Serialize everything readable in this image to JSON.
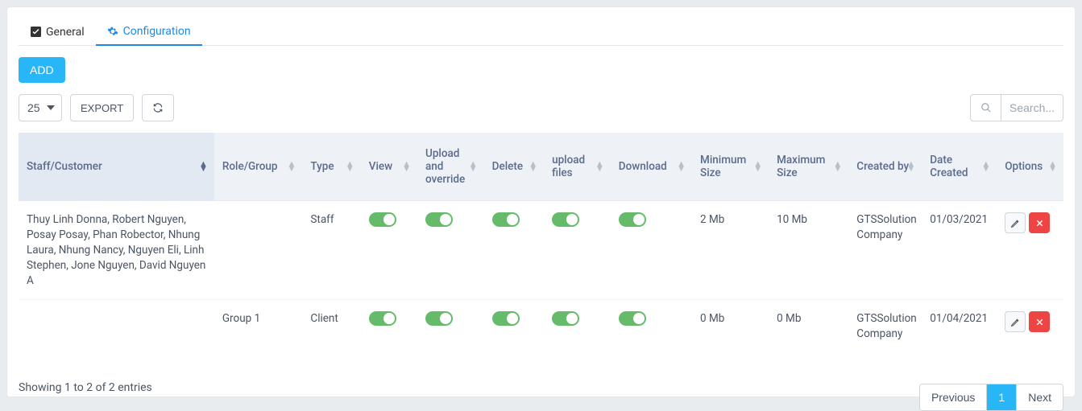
{
  "tabs": {
    "general": "General",
    "configuration": "Configuration"
  },
  "buttons": {
    "add": "ADD",
    "export": "EXPORT"
  },
  "page_size": "25",
  "search": {
    "placeholder": "Search..."
  },
  "columns": {
    "staff": "Staff/Customer",
    "role": "Role/Group",
    "type": "Type",
    "view": "View",
    "upload_override": "Upload and override",
    "delete": "Delete",
    "upload_files": "upload files",
    "download": "Download",
    "min_size": "Minimum Size",
    "max_size": "Maximum Size",
    "created_by": "Created by",
    "date_created": "Date Created",
    "options": "Options"
  },
  "rows": [
    {
      "staff": "Thuy Linh Donna, Robert Nguyen, Posay Posay, Phan Robector, Nhung Laura, Nhung Nancy, Nguyen Eli, Linh Stephen, Jone Nguyen, David Nguyen A",
      "role": "",
      "type": "Staff",
      "min": "2 Mb",
      "max": "10 Mb",
      "created_by": "GTSSolution Company",
      "date": "01/03/2021"
    },
    {
      "staff": "",
      "role": "Group 1",
      "type": "Client",
      "min": "0 Mb",
      "max": "0 Mb",
      "created_by": "GTSSolution Company",
      "date": "01/04/2021"
    }
  ],
  "footer": {
    "info": "Showing 1 to 2 of 2 entries",
    "previous": "Previous",
    "page1": "1",
    "next": "Next"
  }
}
